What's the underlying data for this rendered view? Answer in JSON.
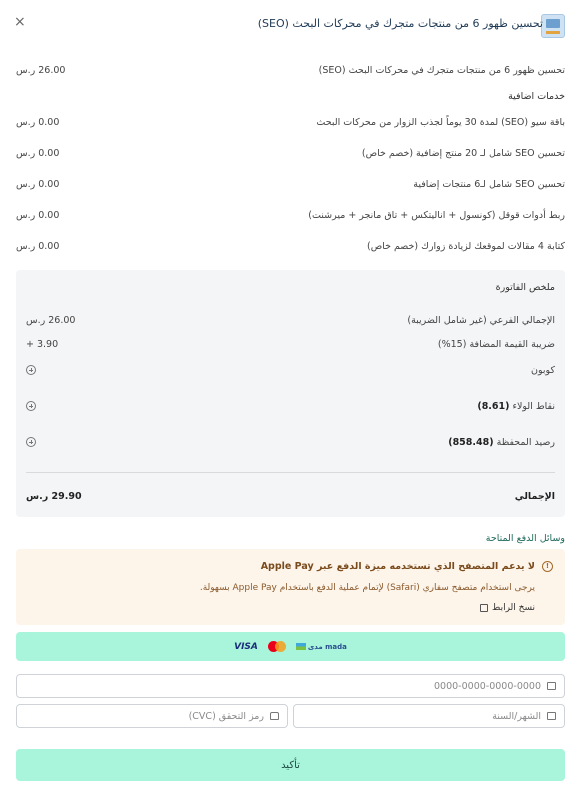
{
  "header": {
    "title": "تحسين ظهور 6 من منتجات متجرك في محركات البحث (SEO)",
    "close_symbol": "×"
  },
  "items": [
    {
      "label": "تحسين ظهور 6 من منتجات متجرك في محركات البحث (SEO)",
      "price": "26.00 ر.س"
    }
  ],
  "addons_title": "خدمات اضافية",
  "addons": [
    {
      "label": "باقة سيو (SEO) لمدة 30 يوماً لجذب الزوار من محركات البحث",
      "price": "0.00 ر.س"
    },
    {
      "label": "تحسين SEO شامل لـ 20 منتج إضافية (خصم خاص)",
      "price": "0.00 ر.س"
    },
    {
      "label": "تحسين SEO شامل لـ6 منتجات إضافية",
      "price": "0.00 ر.س"
    },
    {
      "label": "ربط أدوات قوقل (كونسول + اناليتكس + تاق مانجر + ميرشنت)",
      "price": "0.00 ر.س"
    },
    {
      "label": "كتابة 4 مقالات لموقعك لزيادة زوارك (خصم خاص)",
      "price": "0.00 ر.س"
    }
  ],
  "summary": {
    "title": "ملخص الفاتورة",
    "subtotal_label": "الإجمالي الفرعي (غير شامل الضريبة)",
    "subtotal_value": "26.00 ر.س",
    "vat_label": "ضريبة القيمة المضافة (15%)",
    "vat_value": "+ 3.90",
    "coupon_label": "كوبون",
    "loyalty_label": "نقاط الولاء",
    "loyalty_value": "(8.61)",
    "wallet_label": "رصيد المحفظة",
    "wallet_value": "(858.48)",
    "total_label": "الإجمالي",
    "total_value": "29.90 ر.س"
  },
  "payment": {
    "methods_label": "وسائل الدفع المتاحة",
    "warning_title": "لا يدعم المتصفح الذي تستخدمه ميزة الدفع عبر Apple Pay",
    "warning_text": "يرجى استخدام متصفح سفاري (Safari) لإتمام عملية الدفع باستخدام Apple Pay بسهولة.",
    "copy_link": "نسخ الرابط",
    "card_brands": {
      "visa": "VISA",
      "mada": "مدى mada"
    },
    "card_number_placeholder": "0000-0000-0000-0000",
    "expiry_placeholder": "الشهر/السنة",
    "cvc_placeholder": "رمز التحقق (CVC)",
    "confirm": "تأكيد"
  },
  "icons": {
    "warning": "warning-icon",
    "copy": "copy-icon",
    "card": "credit-card-icon",
    "calendar": "calendar-icon",
    "lock": "lock-icon",
    "add": "plus-circle-icon"
  },
  "colors": {
    "accent": "#a8f5dc",
    "warning_bg": "#fdf4ea",
    "summary_bg": "#f4f5f7"
  }
}
